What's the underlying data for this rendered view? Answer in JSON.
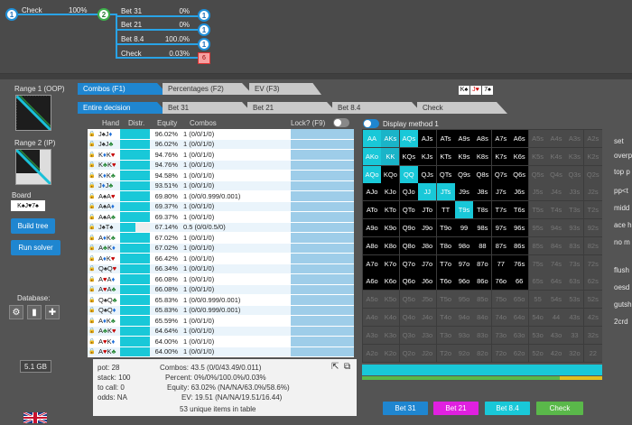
{
  "tree": {
    "node1": "1",
    "node2": "2",
    "edge_check": {
      "label": "Check",
      "value": "100%"
    },
    "branches": [
      {
        "label": "Bet 31",
        "value": "0%",
        "node": "1"
      },
      {
        "label": "Bet 21",
        "value": "0%",
        "node": "1"
      },
      {
        "label": "Bet 8.4",
        "value": "100.0%",
        "node": "1"
      },
      {
        "label": "Check",
        "value": "0.03%",
        "node": "6"
      }
    ]
  },
  "left": {
    "range1": "Range 1 (OOP)",
    "range2": "Range 2 (IP)",
    "board_label": "Board",
    "board_cards": "K♠J♥7♠",
    "build_tree": "Build tree",
    "run_solver": "Run solver",
    "database": "Database:",
    "memory": "5.1 GB"
  },
  "tabs": {
    "combos": "Combos (F1)",
    "percentages": "Percentages (F2)",
    "ev": "EV (F3)",
    "entire": "Entire decision",
    "bet31": "Bet 31",
    "bet21": "Bet 21",
    "bet84": "Bet 8.4",
    "check": "Check",
    "board_cards": [
      "K♠",
      "J♥",
      "7♠"
    ]
  },
  "table": {
    "headers": {
      "hand": "Hand",
      "distr": "Distr.",
      "equity": "Equity",
      "combos": "Combos"
    },
    "lock_label": "Lock? (F9)",
    "rows": [
      {
        "hand": "J♠J♦",
        "eq": "96.02%",
        "combo": "1 (0/0/1/0)",
        "bar": 1
      },
      {
        "hand": "J♠J♣",
        "eq": "96.02%",
        "combo": "1 (0/0/1/0)",
        "bar": 1
      },
      {
        "hand": "K♦K♥",
        "eq": "94.76%",
        "combo": "1 (0/0/1/0)",
        "bar": 1
      },
      {
        "hand": "K♣K♥",
        "eq": "94.76%",
        "combo": "1 (0/0/1/0)",
        "bar": 1
      },
      {
        "hand": "K♦K♣",
        "eq": "94.58%",
        "combo": "1 (0/0/1/0)",
        "bar": 1
      },
      {
        "hand": "J♦J♣",
        "eq": "93.51%",
        "combo": "1 (0/0/1/0)",
        "bar": 1
      },
      {
        "hand": "A♠A♥",
        "eq": "69.80%",
        "combo": "1 (0/0/0.999/0.001)",
        "bar": 1
      },
      {
        "hand": "A♠A♦",
        "eq": "69.37%",
        "combo": "1 (0/0/1/0)",
        "bar": 1
      },
      {
        "hand": "A♠A♣",
        "eq": "69.37%",
        "combo": "1 (0/0/1/0)",
        "bar": 1
      },
      {
        "hand": "J♠T♠",
        "eq": "67.14%",
        "combo": "0.5 (0/0/0.5/0)",
        "bar": 0.5
      },
      {
        "hand": "A♦K♣",
        "eq": "67.02%",
        "combo": "1 (0/0/1/0)",
        "bar": 1
      },
      {
        "hand": "A♣K♦",
        "eq": "67.02%",
        "combo": "1 (0/0/1/0)",
        "bar": 1
      },
      {
        "hand": "A♦K♥",
        "eq": "66.42%",
        "combo": "1 (0/0/1/0)",
        "bar": 1
      },
      {
        "hand": "Q♠Q♥",
        "eq": "66.34%",
        "combo": "1 (0/0/1/0)",
        "bar": 1
      },
      {
        "hand": "A♥A♦",
        "eq": "66.08%",
        "combo": "1 (0/0/1/0)",
        "bar": 1
      },
      {
        "hand": "A♥A♣",
        "eq": "66.08%",
        "combo": "1 (0/0/1/0)",
        "bar": 1
      },
      {
        "hand": "Q♠Q♣",
        "eq": "65.83%",
        "combo": "1 (0/0/0.999/0.001)",
        "bar": 1
      },
      {
        "hand": "Q♠Q♦",
        "eq": "65.83%",
        "combo": "1 (0/0/0.999/0.001)",
        "bar": 1
      },
      {
        "hand": "A♦K♣",
        "eq": "65.59%",
        "combo": "1 (0/0/1/0)",
        "bar": 1
      },
      {
        "hand": "A♣K♥",
        "eq": "64.64%",
        "combo": "1 (0/0/1/0)",
        "bar": 1
      },
      {
        "hand": "A♥K♦",
        "eq": "64.00%",
        "combo": "1 (0/0/1/0)",
        "bar": 1
      },
      {
        "hand": "A♥K♣",
        "eq": "64.00%",
        "combo": "1 (0/0/1/0)",
        "bar": 1
      }
    ]
  },
  "display_method": "Display method 1",
  "grid": {
    "rows": [
      [
        "AA",
        "AKs",
        "AQs",
        "AJs",
        "ATs",
        "A9s",
        "A8s",
        "A7s",
        "A6s",
        "A5s",
        "A4s",
        "A3s",
        "A2s"
      ],
      [
        "AKo",
        "KK",
        "KQs",
        "KJs",
        "KTs",
        "K9s",
        "K8s",
        "K7s",
        "K6s",
        "K5s",
        "K4s",
        "K3s",
        "K2s"
      ],
      [
        "AQo",
        "KQo",
        "QQ",
        "QJs",
        "QTs",
        "Q9s",
        "Q8s",
        "Q7s",
        "Q6s",
        "Q5s",
        "Q4s",
        "Q3s",
        "Q2s"
      ],
      [
        "AJo",
        "KJo",
        "QJo",
        "JJ",
        "JTs",
        "J9s",
        "J8s",
        "J7s",
        "J6s",
        "J5s",
        "J4s",
        "J3s",
        "J2s"
      ],
      [
        "ATo",
        "KTo",
        "QTo",
        "JTo",
        "TT",
        "T9s",
        "T8s",
        "T7s",
        "T6s",
        "T5s",
        "T4s",
        "T3s",
        "T2s"
      ],
      [
        "A9o",
        "K9o",
        "Q9o",
        "J9o",
        "T9o",
        "99",
        "98s",
        "97s",
        "96s",
        "95s",
        "94s",
        "93s",
        "92s"
      ],
      [
        "A8o",
        "K8o",
        "Q8o",
        "J8o",
        "T8o",
        "98o",
        "88",
        "87s",
        "86s",
        "85s",
        "84s",
        "83s",
        "82s"
      ],
      [
        "A7o",
        "K7o",
        "Q7o",
        "J7o",
        "T7o",
        "97o",
        "87o",
        "77",
        "76s",
        "75s",
        "74s",
        "73s",
        "72s"
      ],
      [
        "A6o",
        "K6o",
        "Q6o",
        "J6o",
        "T6o",
        "96o",
        "86o",
        "76o",
        "66",
        "65s",
        "64s",
        "63s",
        "62s"
      ],
      [
        "A5o",
        "K5o",
        "Q5o",
        "J5o",
        "T5o",
        "95o",
        "85o",
        "75o",
        "65o",
        "55",
        "54s",
        "53s",
        "52s"
      ],
      [
        "A4o",
        "K4o",
        "Q4o",
        "J4o",
        "T4o",
        "94o",
        "84o",
        "74o",
        "64o",
        "54o",
        "44",
        "43s",
        "42s"
      ],
      [
        "A3o",
        "K3o",
        "Q3o",
        "J3o",
        "T3o",
        "93o",
        "83o",
        "73o",
        "63o",
        "53o",
        "43o",
        "33",
        "32s"
      ],
      [
        "A2o",
        "K2o",
        "Q2o",
        "J2o",
        "T2o",
        "92o",
        "82o",
        "72o",
        "62o",
        "52o",
        "42o",
        "32o",
        "22"
      ]
    ],
    "cyan_cells": [
      "AA",
      "AKs",
      "AQs",
      "AKo",
      "KK",
      "AQo",
      "QQ",
      "JJ",
      "JTs",
      "T9s"
    ]
  },
  "right_labels": [
    "set",
    "overp",
    "top p",
    "pp<t",
    "midd",
    "ace h",
    "no m",
    "flush",
    "oesd",
    "gutsh",
    "2crd"
  ],
  "stats": {
    "pot": "pot: 28",
    "stack": "stack: 100",
    "to_call": "to call: 0",
    "odds": "odds: NA",
    "combos": "Combos: 43.5 (0/0/43.49/0.011)",
    "percent": "Percent: 0%/0%/100.0%/0.03%",
    "equity": "Equity: 63.02% (NA/NA/63.0%/58.6%)",
    "ev": "EV: 19.51 (NA/NA/19.51/16.44)",
    "unique": "53 unique items in table"
  },
  "actions": {
    "bet31": "Bet 31",
    "bet21": "Bet 21",
    "bet84": "Bet 8.4",
    "check": "Check"
  },
  "colors": {
    "blue": "#1f86d0",
    "magenta": "#e020e0",
    "cyan": "#19c8d8",
    "green": "#5ab84a"
  }
}
